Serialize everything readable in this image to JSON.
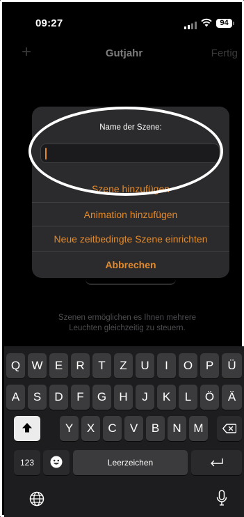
{
  "status": {
    "time": "09:27",
    "battery": "94"
  },
  "nav": {
    "add": "+",
    "title": "Gutjahr",
    "done": "Fertig"
  },
  "hint": "Szenen ermöglichen es Ihnen mehrere Leuchten gleichzeitig zu steuern.",
  "alert": {
    "title": "Name der Szene:",
    "input_value": "",
    "add_scene": "Szene hinzufügen",
    "add_animation": "Animation hinzufügen",
    "timed_scene": "Neue zeitbedingte Szene einrichten",
    "cancel": "Abbrechen"
  },
  "keyboard": {
    "row1": [
      "Q",
      "W",
      "E",
      "R",
      "T",
      "Z",
      "U",
      "I",
      "O",
      "P",
      "Ü"
    ],
    "row2": [
      "A",
      "S",
      "D",
      "F",
      "G",
      "H",
      "J",
      "K",
      "L",
      "Ö",
      "Ä"
    ],
    "row3": [
      "Y",
      "X",
      "C",
      "V",
      "B",
      "N",
      "M"
    ],
    "numbers": "123",
    "space": "Leerzeichen"
  },
  "colors": {
    "accent": "#e48a2a",
    "background": "#000000",
    "alert": "#2b2b2d"
  },
  "icons": [
    "signal-icon",
    "wifi-icon",
    "battery-icon",
    "shift-icon",
    "backspace-icon",
    "emoji-icon",
    "return-icon",
    "globe-icon",
    "microphone-icon"
  ]
}
